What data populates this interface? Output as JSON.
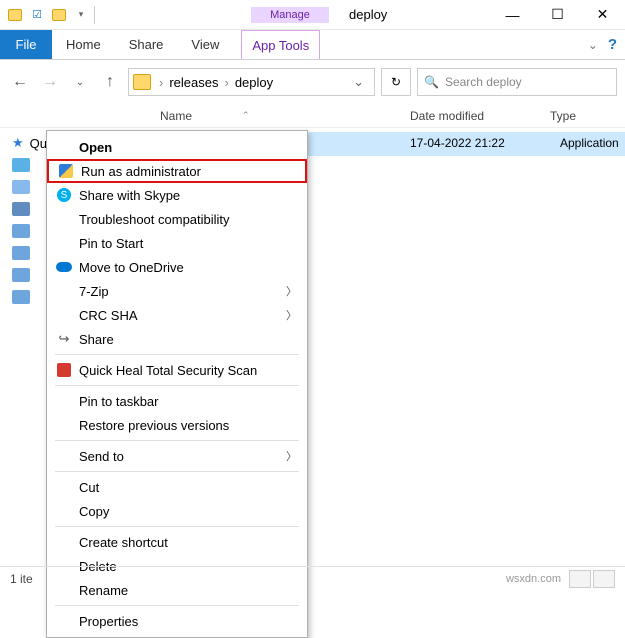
{
  "titlebar": {
    "manage_tab": "Manage",
    "title": "deploy"
  },
  "ribbon": {
    "file": "File",
    "tabs": [
      "Home",
      "Share",
      "View"
    ],
    "app_tools": "App Tools"
  },
  "nav": {
    "back": "←",
    "forward": "→",
    "up": "↑"
  },
  "address": {
    "segments": [
      "releases",
      "deploy"
    ]
  },
  "search": {
    "placeholder": "Search deploy"
  },
  "columns": {
    "name": "Name",
    "date": "Date modified",
    "type": "Type"
  },
  "navpane": {
    "quick_access": "Quick access"
  },
  "file_row": {
    "date": "17-04-2022 21:22",
    "type": "Application"
  },
  "context_menu": {
    "open": "Open",
    "run_admin": "Run as administrator",
    "share_skype": "Share with Skype",
    "troubleshoot": "Troubleshoot compatibility",
    "pin_start": "Pin to Start",
    "onedrive": "Move to OneDrive",
    "seven_zip": "7-Zip",
    "crc_sha": "CRC SHA",
    "share": "Share",
    "quick_heal": "Quick Heal Total Security Scan",
    "pin_taskbar": "Pin to taskbar",
    "restore": "Restore previous versions",
    "send_to": "Send to",
    "cut": "Cut",
    "copy": "Copy",
    "shortcut": "Create shortcut",
    "delete": "Delete",
    "rename": "Rename",
    "properties": "Properties"
  },
  "status": {
    "count": "1 ite",
    "watermark": "wsxdn.com"
  }
}
